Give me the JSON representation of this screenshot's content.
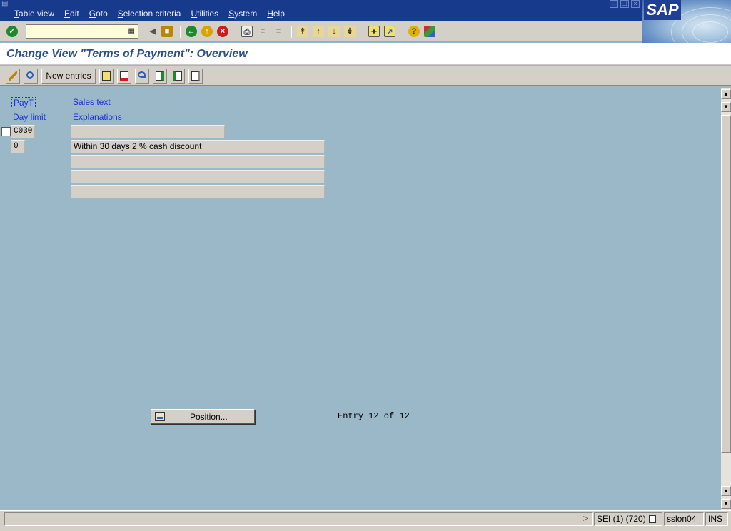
{
  "menubar": {
    "items": [
      {
        "label": "Table view",
        "accel": "T",
        "rest": "able view"
      },
      {
        "label": "Edit",
        "accel": "E",
        "rest": "dit"
      },
      {
        "label": "Goto",
        "accel": "G",
        "rest": "oto"
      },
      {
        "label": "Selection criteria",
        "accel": "S",
        "rest": "election criteria"
      },
      {
        "label": "Utilities",
        "accel": "U",
        "rest": "tilities"
      },
      {
        "label": "System",
        "accel": "S",
        "rest": "ystem"
      },
      {
        "label": "Help",
        "accel": "H",
        "rest": "elp"
      }
    ],
    "logo_text": "SAP"
  },
  "toolbar": {
    "command_field_value": "",
    "icons": [
      "enter-icon",
      "back-arrow-icon",
      "save-icon",
      "back-icon",
      "exit-icon",
      "cancel-icon",
      "print-icon",
      "find-icon",
      "find-next-icon",
      "first-page-icon",
      "previous-page-icon",
      "next-page-icon",
      "last-page-icon",
      "create-session-icon",
      "shortcut-icon",
      "help-icon",
      "layout-icon"
    ]
  },
  "title": "Change View \"Terms of Payment\": Overview",
  "app_toolbar": {
    "new_entries_label": "New entries"
  },
  "form": {
    "header_labels": {
      "payt": "PayT",
      "sales_text": "Sales text",
      "day_limit": "Day limit",
      "explanations": "Explanations"
    },
    "payt_value": "C030",
    "sales_text_value": "",
    "day_limit_value": "0",
    "explanation_lines": [
      "Within 30 days 2 % cash discount",
      "",
      "",
      ""
    ]
  },
  "position_button_label": "Position...",
  "entry_text": "Entry 12 of 12",
  "statusbar": {
    "message": "",
    "system": "SEI (1) (720)",
    "server": "sslon04",
    "mode": "INS"
  },
  "colors": {
    "menubar_bg": "#183a8c",
    "content_bg": "#9ab8c8",
    "label_blue": "#1b2ee0",
    "title_blue": "#2f4f8f"
  }
}
